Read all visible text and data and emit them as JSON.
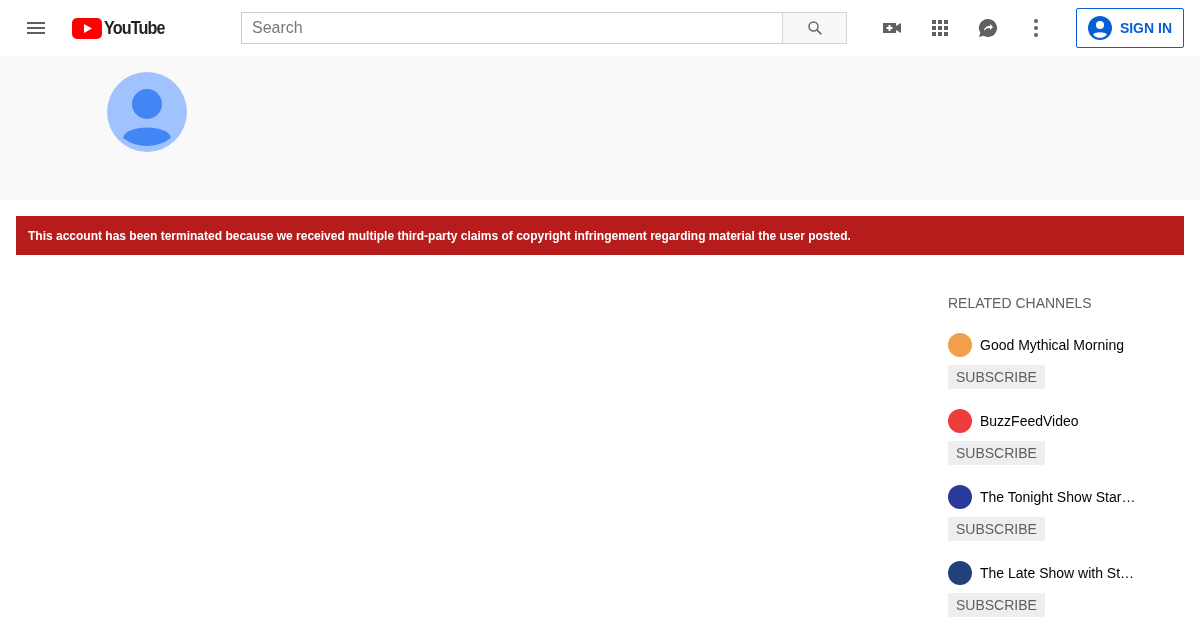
{
  "header": {
    "logo_text": "YouTube",
    "search": {
      "placeholder": "Search"
    },
    "sign_in": "SIGN IN"
  },
  "alert": {
    "text": "This account has been terminated because we received multiple third-party claims of copyright infringement regarding material the user posted."
  },
  "related_channels": {
    "title": "RELATED CHANNELS",
    "channels": [
      {
        "name": "Good Mythical Morning",
        "color": "#f0a04a",
        "button": "SUBSCRIBE"
      },
      {
        "name": "BuzzFeedVideo",
        "color": "#ee3b3b",
        "button": "SUBSCRIBE"
      },
      {
        "name": "The Tonight Show Star…",
        "color": "#2a3a9a",
        "button": "SUBSCRIBE"
      },
      {
        "name": "The Late Show with St…",
        "color": "#24407a",
        "button": "SUBSCRIBE"
      }
    ]
  }
}
